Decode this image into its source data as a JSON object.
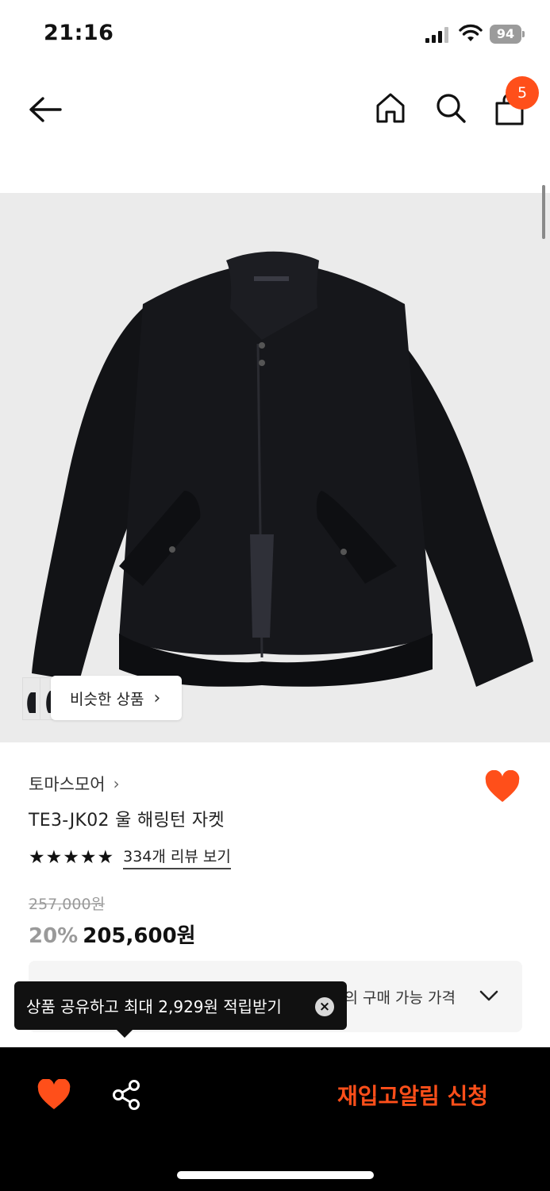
{
  "status_bar": {
    "time": "21:16",
    "battery": "94"
  },
  "header": {
    "cart_count": "5"
  },
  "product_image": {
    "similar_label": "비슷한 상품",
    "similar_chevron": "›"
  },
  "product": {
    "brand": "토마스모어",
    "brand_chevron": "›",
    "name": "TE3-JK02 울 해링턴 자켓",
    "rating_stars": [
      "★",
      "★",
      "★",
      "★",
      "★"
    ],
    "review_link": "334개 리뷰 보기",
    "original_price": "257,000원",
    "discount": "20%",
    "sale_price": "205,600원",
    "wishlisted": true
  },
  "coupon": {
    "text": "나의 구매 가능 가격"
  },
  "tooltip": {
    "text": "상품 공유하고 최대 2,929원 적립받기",
    "close_glyph": "×"
  },
  "bottom_bar": {
    "restock_label": "재입고알림 신청"
  },
  "colors": {
    "accent": "#ff4f1a",
    "black": "#000000",
    "image_bg": "#ebebeb"
  },
  "icons": [
    "back-arrow-icon",
    "home-icon",
    "search-icon",
    "cart-icon",
    "heart-icon",
    "share-icon",
    "chevron-down-icon",
    "close-icon"
  ]
}
